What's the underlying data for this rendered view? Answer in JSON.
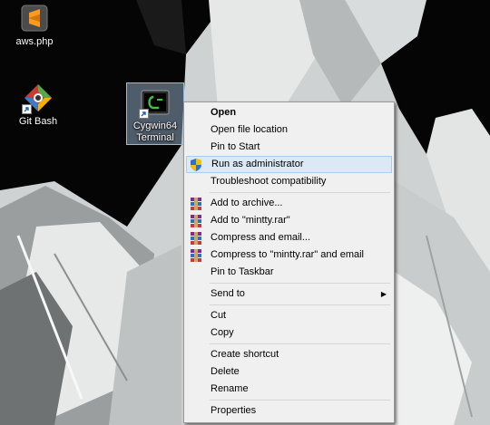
{
  "desktop": {
    "icons": [
      {
        "label": "aws.php"
      },
      {
        "label": "Git Bash"
      },
      {
        "label": "Cygwin64 Terminal"
      }
    ]
  },
  "context_menu": {
    "items": [
      {
        "label": "Open"
      },
      {
        "label": "Open file location"
      },
      {
        "label": "Pin to Start"
      },
      {
        "label": "Run as administrator"
      },
      {
        "label": "Troubleshoot compatibility"
      },
      {
        "label": "Add to archive..."
      },
      {
        "label": "Add to \"mintty.rar\""
      },
      {
        "label": "Compress and email..."
      },
      {
        "label": "Compress to \"mintty.rar\" and email"
      },
      {
        "label": "Pin to Taskbar"
      },
      {
        "label": "Send to"
      },
      {
        "label": "Cut"
      },
      {
        "label": "Copy"
      },
      {
        "label": "Create shortcut"
      },
      {
        "label": "Delete"
      },
      {
        "label": "Rename"
      },
      {
        "label": "Properties"
      }
    ]
  },
  "colors": {
    "highlight": "#dbe9f7",
    "menu_bg": "#f0f0f0"
  }
}
